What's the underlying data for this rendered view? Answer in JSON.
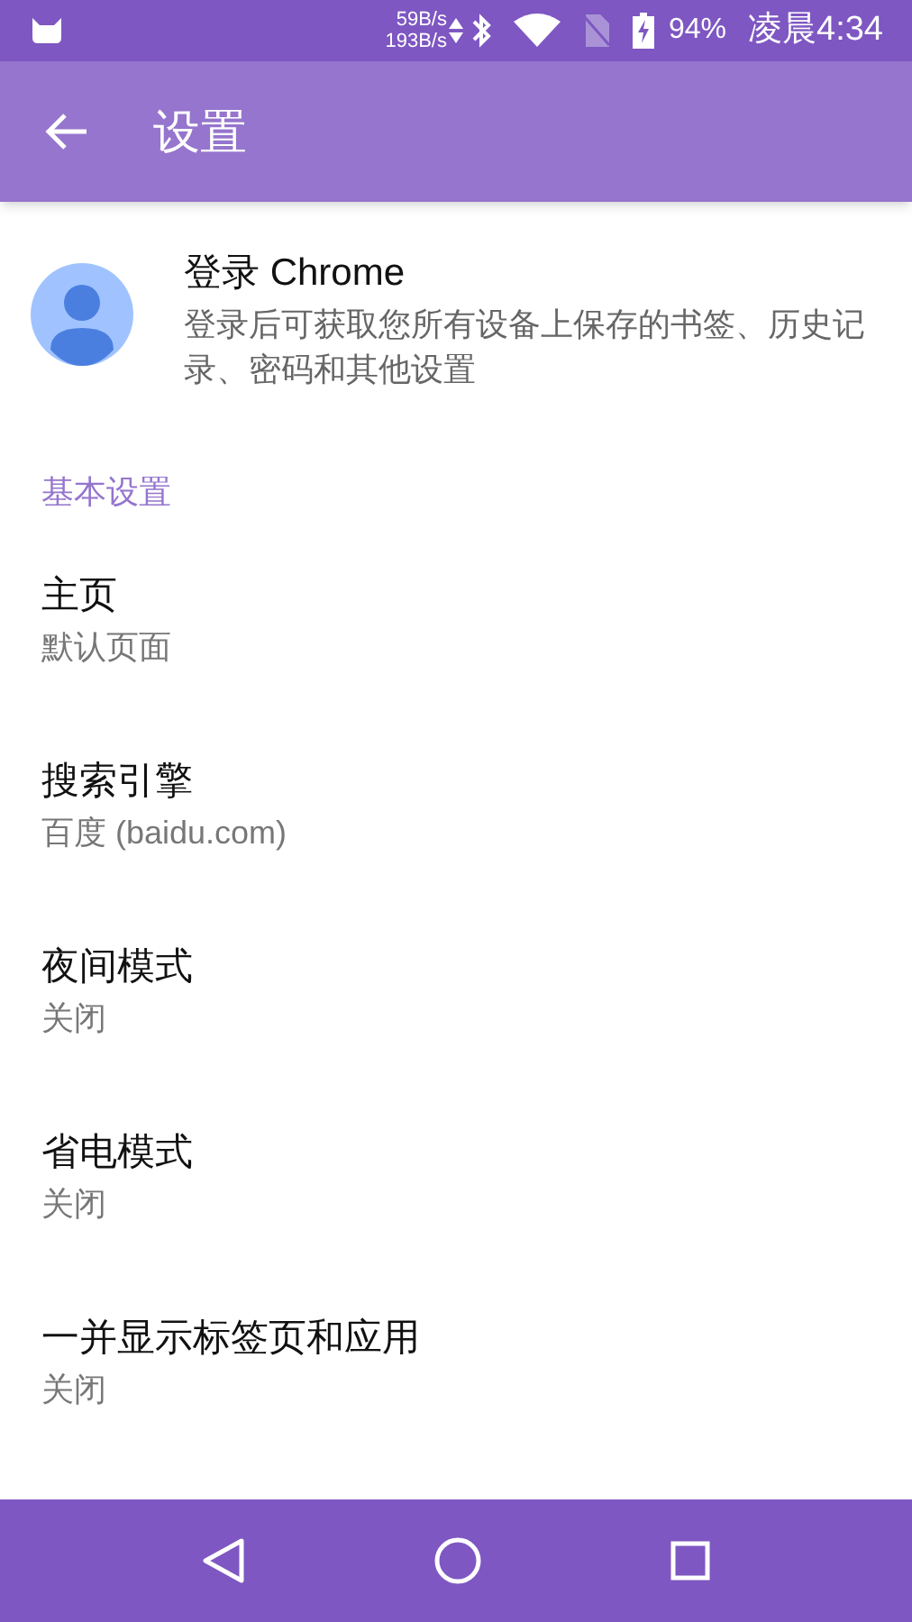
{
  "status_bar": {
    "upload_speed": "59B/s",
    "download_speed": "193B/s",
    "battery": "94%",
    "time": "凌晨4:34"
  },
  "app_bar": {
    "title": "设置"
  },
  "account": {
    "title": "登录 Chrome",
    "description": "登录后可获取您所有设备上保存的书签、历史记录、密码和其他设置"
  },
  "section": {
    "title": "基本设置"
  },
  "items": [
    {
      "title": "主页",
      "subtitle": "默认页面"
    },
    {
      "title": "搜索引擎",
      "subtitle": "百度 (baidu.com)"
    },
    {
      "title": "夜间模式",
      "subtitle": "关闭"
    },
    {
      "title": "省电模式",
      "subtitle": "关闭"
    },
    {
      "title": "一并显示标签页和应用",
      "subtitle": "关闭"
    }
  ]
}
